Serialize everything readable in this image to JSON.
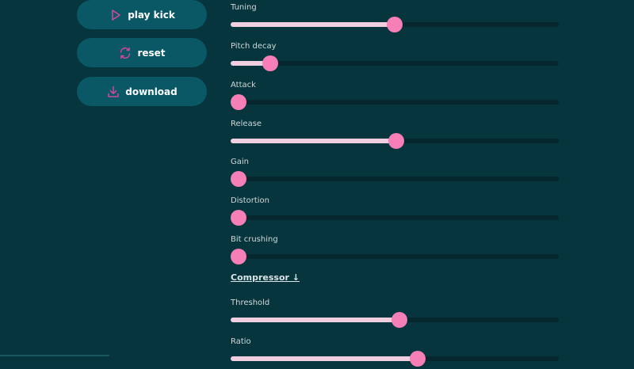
{
  "buttons": {
    "play": {
      "label": "play kick",
      "icon": "play-icon"
    },
    "reset": {
      "label": "reset",
      "icon": "refresh-icon"
    },
    "download": {
      "label": "download",
      "icon": "download-icon"
    }
  },
  "colors": {
    "background": "#06353d",
    "button": "#0a5866",
    "track": "#05272d",
    "fill": "#f0cfe0",
    "thumb": "#f57fb6",
    "icon": "#d0489a"
  },
  "parameters": [
    {
      "label": "Tuning",
      "value": 0.5
    },
    {
      "label": "Pitch decay",
      "value": 0.12
    },
    {
      "label": "Attack",
      "value": 0.025
    },
    {
      "label": "Release",
      "value": 0.505
    },
    {
      "label": "Gain",
      "value": 0.025
    },
    {
      "label": "Distortion",
      "value": 0.025
    },
    {
      "label": "Bit crushing",
      "value": 0.025
    }
  ],
  "compressor": {
    "header": "Compressor ↓",
    "parameters": [
      {
        "label": "Threshold",
        "value": 0.515
      },
      {
        "label": "Ratio",
        "value": 0.57
      }
    ]
  }
}
